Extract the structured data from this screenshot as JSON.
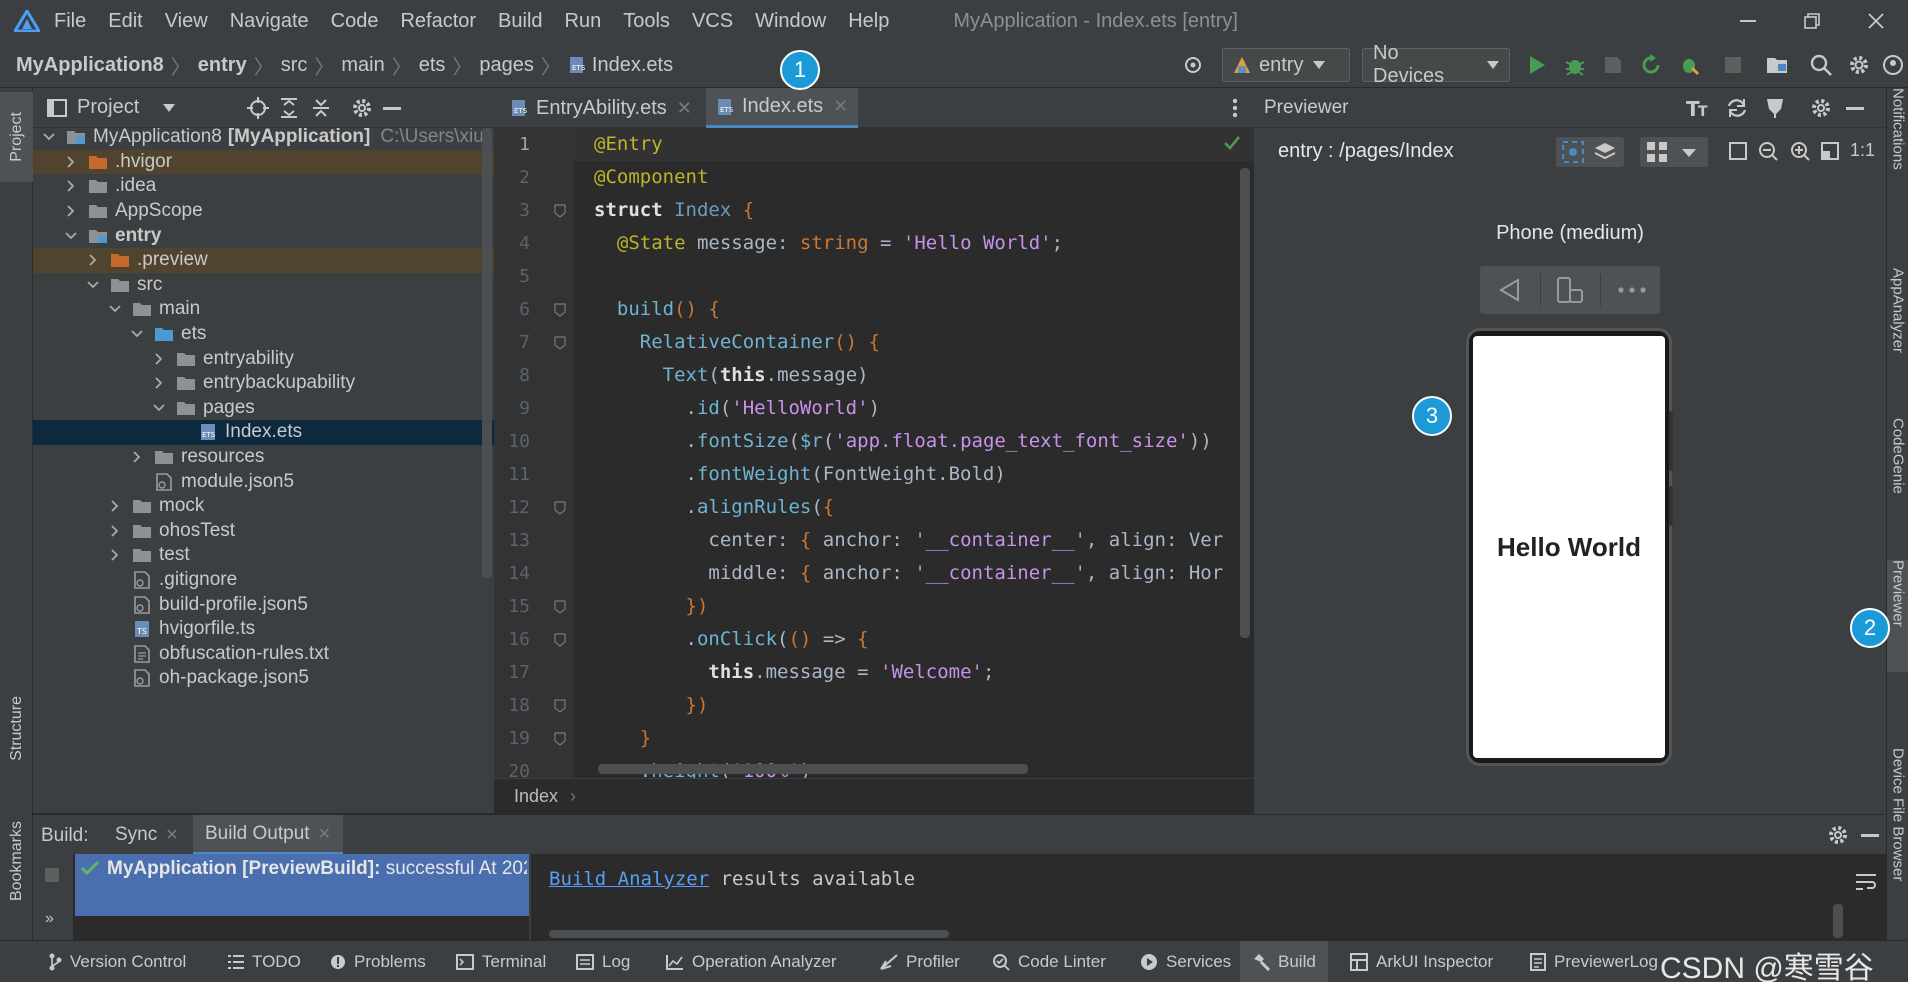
{
  "menubar": {
    "items": [
      "File",
      "Edit",
      "View",
      "Navigate",
      "Code",
      "Refactor",
      "Build",
      "Run",
      "Tools",
      "VCS",
      "Window",
      "Help"
    ],
    "window_title": "MyApplication - Index.ets [entry]"
  },
  "navbar": {
    "breadcrumbs": [
      "MyApplication8",
      "entry",
      "src",
      "main",
      "ets",
      "pages",
      "Index.ets"
    ],
    "run_config": "entry",
    "device": "No Devices"
  },
  "left_strip": {
    "project": "Project",
    "structure": "Structure",
    "bookmarks": "Bookmarks"
  },
  "project": {
    "title": "Project",
    "tree": [
      {
        "label": "MyApplication8",
        "bold_suffix": "[MyApplication]",
        "path": "C:\\Users\\xiu",
        "depth": 0,
        "expanded": true,
        "icon": "module"
      },
      {
        "label": ".hvigor",
        "depth": 1,
        "expanded": false,
        "icon": "folder-orange"
      },
      {
        "label": ".idea",
        "depth": 1,
        "expanded": false,
        "icon": "folder"
      },
      {
        "label": "AppScope",
        "depth": 1,
        "expanded": false,
        "icon": "folder"
      },
      {
        "label": "entry",
        "depth": 1,
        "expanded": true,
        "icon": "folder-module",
        "bold": true
      },
      {
        "label": ".preview",
        "depth": 2,
        "expanded": false,
        "icon": "folder-orange"
      },
      {
        "label": "src",
        "depth": 2,
        "expanded": true,
        "icon": "folder"
      },
      {
        "label": "main",
        "depth": 3,
        "expanded": true,
        "icon": "folder"
      },
      {
        "label": "ets",
        "depth": 4,
        "expanded": true,
        "icon": "folder-blue"
      },
      {
        "label": "entryability",
        "depth": 5,
        "expanded": false,
        "icon": "folder"
      },
      {
        "label": "entrybackupability",
        "depth": 5,
        "expanded": false,
        "icon": "folder"
      },
      {
        "label": "pages",
        "depth": 5,
        "expanded": true,
        "icon": "folder"
      },
      {
        "label": "Index.ets",
        "depth": 6,
        "icon": "file-ets",
        "selected": true
      },
      {
        "label": "resources",
        "depth": 4,
        "expanded": false,
        "icon": "folder"
      },
      {
        "label": "module.json5",
        "depth": 4,
        "icon": "file-json"
      },
      {
        "label": "mock",
        "depth": 3,
        "expanded": false,
        "icon": "folder"
      },
      {
        "label": "ohosTest",
        "depth": 3,
        "expanded": false,
        "icon": "folder"
      },
      {
        "label": "test",
        "depth": 3,
        "expanded": false,
        "icon": "folder"
      },
      {
        "label": ".gitignore",
        "depth": 3,
        "icon": "file-json"
      },
      {
        "label": "build-profile.json5",
        "depth": 3,
        "icon": "file-json"
      },
      {
        "label": "hvigorfile.ts",
        "depth": 3,
        "icon": "file-ts"
      },
      {
        "label": "obfuscation-rules.txt",
        "depth": 3,
        "icon": "file-txt"
      },
      {
        "label": "oh-package.json5",
        "depth": 3,
        "icon": "file-json"
      }
    ]
  },
  "editor": {
    "tabs": [
      {
        "label": "EntryAbility.ets",
        "active": false
      },
      {
        "label": "Index.ets",
        "active": true
      }
    ],
    "line_numbers": [
      "1",
      "2",
      "3",
      "4",
      "5",
      "6",
      "7",
      "8",
      "9",
      "10",
      "11",
      "12",
      "13",
      "14",
      "15",
      "16",
      "17",
      "18",
      "19",
      "20"
    ],
    "breadcrumb": "Index"
  },
  "previewer": {
    "title": "Previewer",
    "route": "entry : /pages/Index",
    "zoom_label": "1:1",
    "device_name": "Phone (medium)",
    "screen_text": "Hello World"
  },
  "right_strip": {
    "notifications": "Notifications",
    "appanalyzer": "AppAnalyzer",
    "codegenie": "CodeGenie",
    "previewer": "Previewer",
    "device_file_browser": "Device File Browser"
  },
  "build": {
    "label": "Build:",
    "tabs": [
      "Sync",
      "Build Output"
    ],
    "result_bold": "MyApplication [PreviewBuild]:",
    "result_text": "successful At 202",
    "analyzer_link": "Build Analyzer",
    "analyzer_text": "results available"
  },
  "statusbar": {
    "items": [
      "Version Control",
      "TODO",
      "Problems",
      "Terminal",
      "Log",
      "Operation Analyzer",
      "Profiler",
      "Code Linter",
      "Services",
      "Build",
      "ArkUI Inspector",
      "PreviewerLog"
    ]
  },
  "badges": [
    "1",
    "2",
    "3"
  ],
  "watermark": "CSDN @寒雪谷",
  "colors": {
    "accent": "#4a88c7",
    "badge": "#1a9ad6",
    "run_green": "#499c54",
    "selection": "#0d293e"
  }
}
